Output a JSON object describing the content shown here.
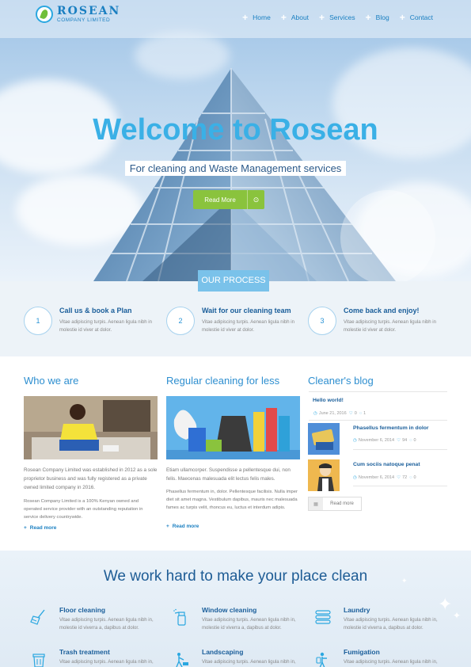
{
  "brand": {
    "name": "ROSEAN",
    "subtitle": "COMPANY LIMITED"
  },
  "nav": [
    {
      "label": "Home"
    },
    {
      "label": "About"
    },
    {
      "label": "Services"
    },
    {
      "label": "Blog"
    },
    {
      "label": "Contact"
    }
  ],
  "hero": {
    "title": "Welcome to Rosean",
    "subtitle": "For cleaning and Waste Management services",
    "button": "Read More"
  },
  "process": {
    "tab": "OUR PROCESS",
    "steps": [
      {
        "num": "1",
        "title": "Call us & book a Plan",
        "text": "Vitae adipiscing turpis. Aenean ligula nibh in molestie id viver at dolor."
      },
      {
        "num": "2",
        "title": "Wait for our cleaning team",
        "text": "Vitae adipiscing turpis. Aenean ligula nibh in molestie id viver at dolor."
      },
      {
        "num": "3",
        "title": "Come back and enjoy!",
        "text": "Vitae adipiscing turpis. Aenean ligula nibh in molestie id viver at dolor."
      }
    ]
  },
  "who": {
    "title": "Who we are",
    "p1": "Rosean Company Limited was established in 2012 as a sole proprietor business and was fully registered as a private owned limited company in 2016.",
    "p2": "Rosean Company Limited is a 100% Kenyan owned and operated service provider with an outstanding reputation in service delivery countrywide.",
    "link": "Read more"
  },
  "regular": {
    "title": "Regular cleaning for less",
    "p1": "Etiam ullamcorper. Suspendisse a pellentesque dui, non felis. Maecenas malesuada elit lectus felis males.",
    "p2": "Phasellus fermentum in, dolor. Pellentesque facilisis. Nulla imper diet sit amet magna. Vestibulum dapibus, mauris nec malesuada fames ac turpis velit, rhoncus eu, luctus et interdum adipis.",
    "link": "Read more"
  },
  "blog": {
    "title": "Cleaner's blog",
    "posts": [
      {
        "title": "Hello world!",
        "date": "June 21, 2016",
        "likes": "0",
        "comments": "1"
      },
      {
        "title": "Phasellus fermentum in dolor",
        "date": "November 6, 2014",
        "likes": "94",
        "comments": "0"
      },
      {
        "title": "Cum sociis natoque penat",
        "date": "November 6, 2014",
        "likes": "72",
        "comments": "0"
      }
    ],
    "button": "Read more"
  },
  "services": {
    "title": "We work hard to make your place clean",
    "items": [
      {
        "title": "Floor cleaning",
        "text": "Vitae adipiscing turpis. Aenean ligula nibh in, molestie id viverra a, dapibus at dolor.",
        "icon": "broom-icon"
      },
      {
        "title": "Window cleaning",
        "text": "Vitae adipiscing turpis. Aenean ligula nibh in, molestie id viverra a, dapibus at dolor.",
        "icon": "spray-bottle-icon"
      },
      {
        "title": "Laundry",
        "text": "Vitae adipiscing turpis. Aenean ligula nibh in, molestie id viverra a, dapibus at dolor.",
        "icon": "towels-icon"
      },
      {
        "title": "Trash treatment",
        "text": "Vitae adipiscing turpis. Aenean ligula nibh in, molestie id viverra a, dapibus at dolor.",
        "icon": "trash-bin-icon"
      },
      {
        "title": "Landscaping",
        "text": "Vitae adipiscing turpis. Aenean ligula nibh in, molestie id viverra a, dapibus at dolor.",
        "icon": "lawn-mower-icon"
      },
      {
        "title": "Fumigation",
        "text": "Vitae adipiscing turpis. Aenean ligula nibh in, molestie id viverra a, dapibus at dolor.",
        "icon": "fumigation-icon"
      }
    ]
  },
  "colors": {
    "primary": "#2aa7e0",
    "accent": "#8ac33d",
    "dark_blue": "#1a5e9a"
  }
}
